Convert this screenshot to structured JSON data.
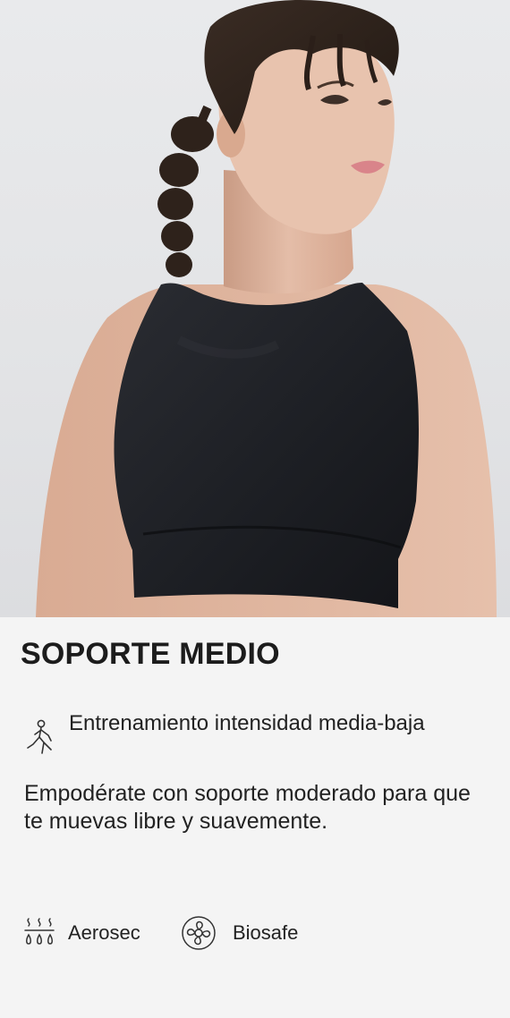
{
  "product": {
    "image_alt": "Mujer con top deportivo negro de espalda cruzada",
    "support_level": "SOPORTE MEDIO",
    "activity": {
      "icon": "yoga-figure-icon",
      "text": "Entrenamiento intensidad media-baja"
    },
    "description": "Empodérate con soporte moderado para que te muevas libre y suavemente.",
    "features": [
      {
        "icon": "sweat-drops-icon",
        "label": "Aerosec"
      },
      {
        "icon": "antimicrobial-icon",
        "label": "Biosafe"
      }
    ]
  },
  "colors": {
    "background": "#f4f4f4",
    "text": "#1f1f1f",
    "garment": "#1d1f24"
  }
}
